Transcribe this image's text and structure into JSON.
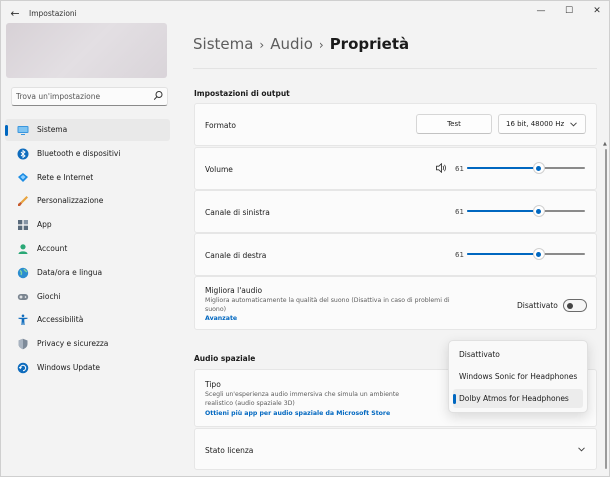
{
  "window": {
    "title": "Impostazioni",
    "controls": {
      "minimize": "—",
      "maximize": "☐",
      "close": "✕"
    },
    "back": "←"
  },
  "sidebar": {
    "search": {
      "placeholder": "Trova un'impostazione"
    },
    "items": [
      {
        "label": "Sistema",
        "icon": "system-icon",
        "active": true
      },
      {
        "label": "Bluetooth e dispositivi",
        "icon": "bluetooth-icon"
      },
      {
        "label": "Rete e Internet",
        "icon": "network-icon"
      },
      {
        "label": "Personalizzazione",
        "icon": "brush-icon"
      },
      {
        "label": "App",
        "icon": "apps-icon"
      },
      {
        "label": "Account",
        "icon": "account-icon"
      },
      {
        "label": "Data/ora e lingua",
        "icon": "globe-icon"
      },
      {
        "label": "Giochi",
        "icon": "gamepad-icon"
      },
      {
        "label": "Accessibilità",
        "icon": "accessibility-icon"
      },
      {
        "label": "Privacy e sicurezza",
        "icon": "shield-icon"
      },
      {
        "label": "Windows Update",
        "icon": "update-icon"
      }
    ]
  },
  "breadcrumb": {
    "part1": "Sistema",
    "part2": "Audio",
    "current": "Proprietà",
    "sep": "›"
  },
  "output": {
    "section_title": "Impostazioni di output",
    "format": {
      "label": "Formato",
      "test_label": "Test",
      "selected": "16 bit, 48000 Hz"
    },
    "volume": {
      "label": "Volume",
      "value": "61",
      "level": 0.61
    },
    "left": {
      "label": "Canale di sinistra",
      "value": "61",
      "level": 0.61
    },
    "right": {
      "label": "Canale di destra",
      "value": "61",
      "level": 0.61
    },
    "enhance": {
      "title": "Migliora l'audio",
      "desc": "Migliora automaticamente la qualità del suono (Disattiva in caso di problemi di suono)",
      "link": "Avanzate",
      "state": "Disattivato"
    }
  },
  "spatial": {
    "section_title": "Audio spaziale",
    "type": {
      "title": "Tipo",
      "desc": "Scegli un'esperienza audio immersiva che simula un ambiente realistico (audio spaziale 3D)",
      "link": "Ottieni più app per audio spaziale da Microsoft Store"
    },
    "license": {
      "label": "Stato licenza"
    }
  },
  "dropdown": {
    "options": [
      "Disattivato",
      "Windows Sonic for Headphones",
      "Dolby Atmos for Headphones"
    ],
    "selected": "Dolby Atmos for Headphones"
  },
  "colors": {
    "accent": "#0067c0",
    "background": "#f3f3f3",
    "card": "#fbfbfb"
  }
}
